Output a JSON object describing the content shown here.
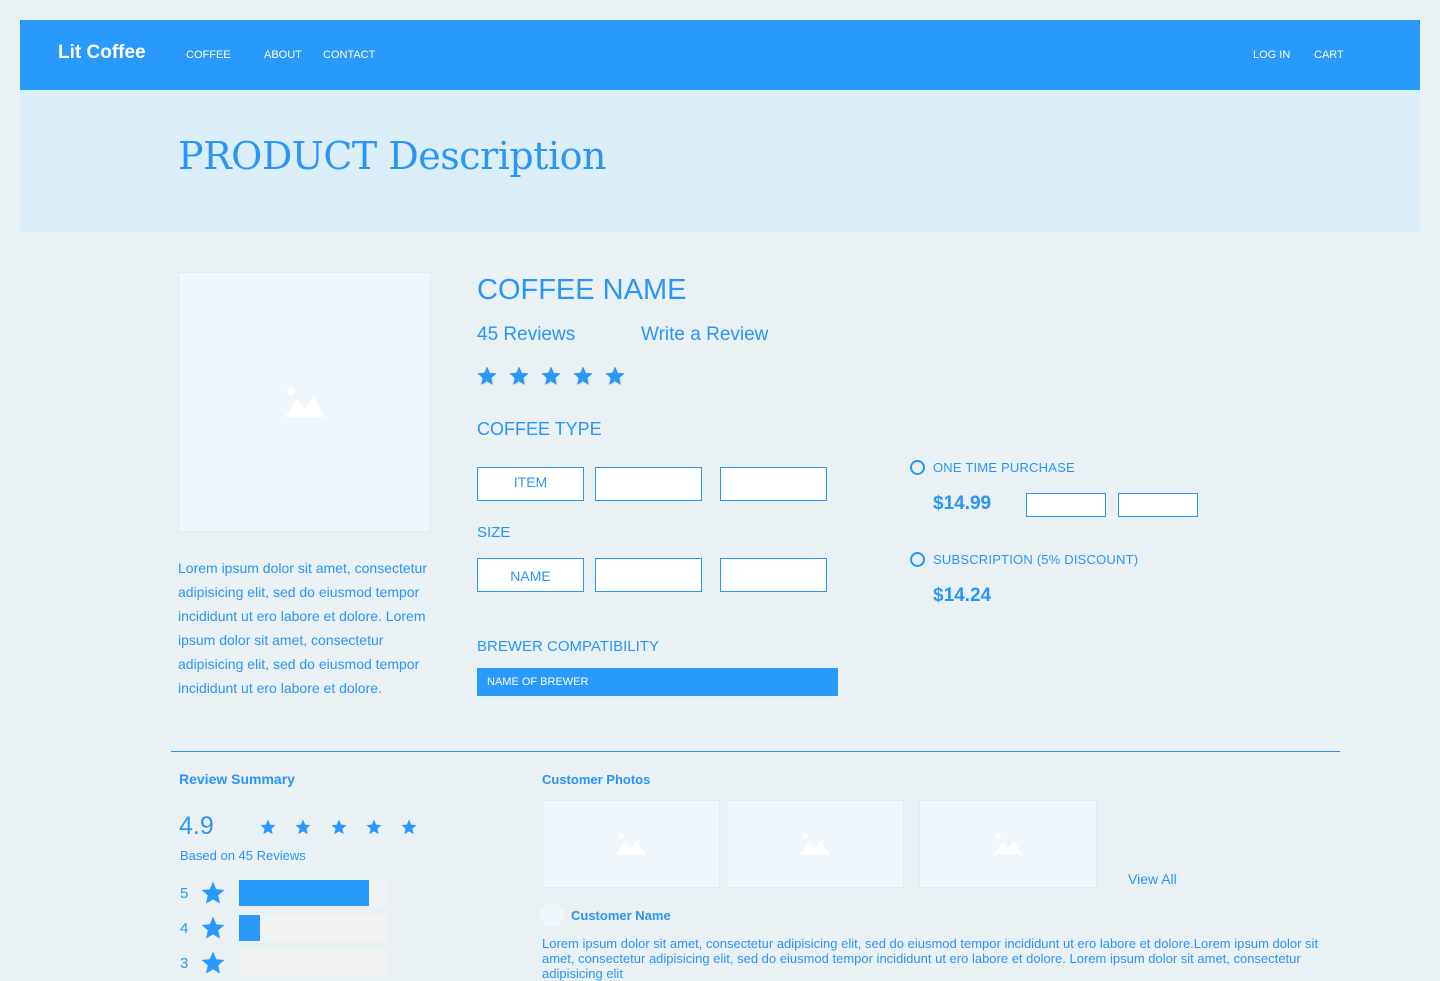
{
  "nav": {
    "brand": "Lit Coffee",
    "links": [
      "COFFEE",
      "ABOUT",
      "CONTACT"
    ],
    "login": "LOG IN",
    "cart": "CART"
  },
  "hero": {
    "title": "PRODUCT Description"
  },
  "product": {
    "description": "Lorem ipsum dolor sit amet, consectetur adipisicing elit, sed do eiusmod tempor incididunt ut ero labore et dolore. Lorem ipsum dolor sit amet, consectetur adipisicing elit, sed do eiusmod tempor incididunt ut ero labore et dolore.",
    "name": "COFFEE NAME",
    "reviews_count_label": "45 Reviews",
    "write_review_label": "Write a Review",
    "stars": 5,
    "coffee_type_label": "COFFEE TYPE",
    "coffee_type_options": [
      "ITEM",
      "",
      ""
    ],
    "size_label": "SIZE",
    "size_options": [
      "NAME",
      "",
      ""
    ],
    "brewer_label": "BREWER COMPATIBILITY",
    "brewer_value": "NAME OF BREWER"
  },
  "purchase": {
    "one_time_label": "ONE TIME PURCHASE",
    "one_time_price": "$14.99",
    "subscription_label": "SUBSCRIPTION (5% DISCOUNT)",
    "subscription_price": "$14.24"
  },
  "reviews": {
    "summary_title": "Review Summary",
    "rating": "4.9",
    "based_on": "Based on 45 Reviews",
    "breakdown": [
      {
        "stars": "5",
        "fraction": 0.87
      },
      {
        "stars": "4",
        "fraction": 0.14
      },
      {
        "stars": "3",
        "fraction": 0.0
      }
    ],
    "photos_title": "Customer Photos",
    "view_all": "View All",
    "customer_name": "Customer Name",
    "review_text": "Lorem ipsum dolor sit amet, consectetur adipisicing elit, sed do eiusmod tempor incididunt ut ero labore et dolore.Lorem ipsum dolor sit amet, consectetur adipisicing elit, sed do eiusmod tempor incididunt ut ero labore et dolore. Lorem ipsum dolor sit amet, consectetur adipisicing elit"
  },
  "colors": {
    "accent": "#2999fb",
    "text": "#2996f5",
    "page_bg": "#e9f1f5",
    "hero_bg": "#dbeef8"
  },
  "icons": {
    "star": "star-icon",
    "image": "image-placeholder-icon"
  }
}
